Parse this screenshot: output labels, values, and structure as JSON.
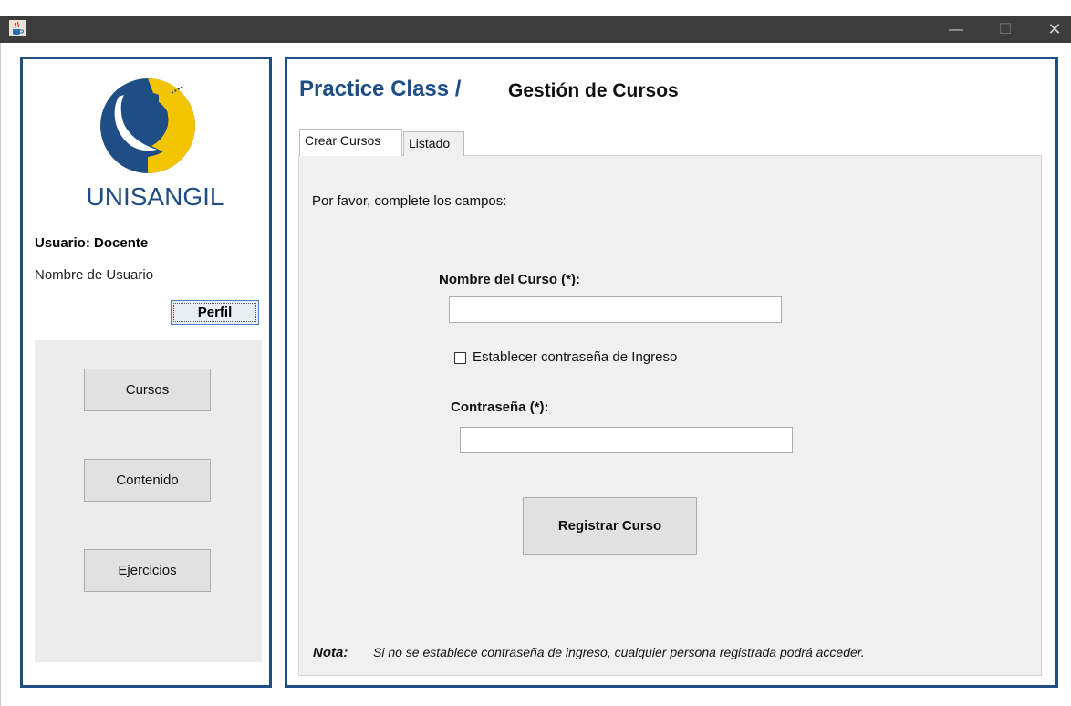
{
  "window": {
    "minimize_glyph": "—",
    "maximize_glyph": "☐",
    "close_glyph": "✕"
  },
  "sidebar": {
    "brand": "UNISANGIL",
    "user_role": "Usuario: Docente",
    "user_name": "Nombre de Usuario",
    "profile_button": "Perfil",
    "nav": [
      {
        "label": "Cursos"
      },
      {
        "label": "Contenido"
      },
      {
        "label": "Ejercicios"
      }
    ]
  },
  "header": {
    "app_title": "Practice Class /",
    "page_title": "Gestión de Cursos"
  },
  "tabs": [
    {
      "label": "Crear Cursos",
      "active": true
    },
    {
      "label": "Listado",
      "active": false
    }
  ],
  "form": {
    "instructions": "Por favor, complete los campos:",
    "course_name_label": "Nombre del Curso (*):",
    "course_name_value": "",
    "set_password_checkbox_label": "Establecer contraseña de Ingreso",
    "set_password_checked": false,
    "password_label": "Contraseña (*):",
    "password_value": "",
    "submit_button": "Registrar Curso"
  },
  "note": {
    "label": "Nota:",
    "text": "Si no se establece contraseña de ingreso, cualquier persona registrada podrá acceder."
  },
  "colors": {
    "accent_blue": "#1f4e85",
    "logo_yellow": "#f2c500",
    "titlebar": "#3c3c3c",
    "panel_gray": "#f0f0f0"
  },
  "icons": {
    "app": "java-cup-icon",
    "logo": "unisangil-logo"
  }
}
